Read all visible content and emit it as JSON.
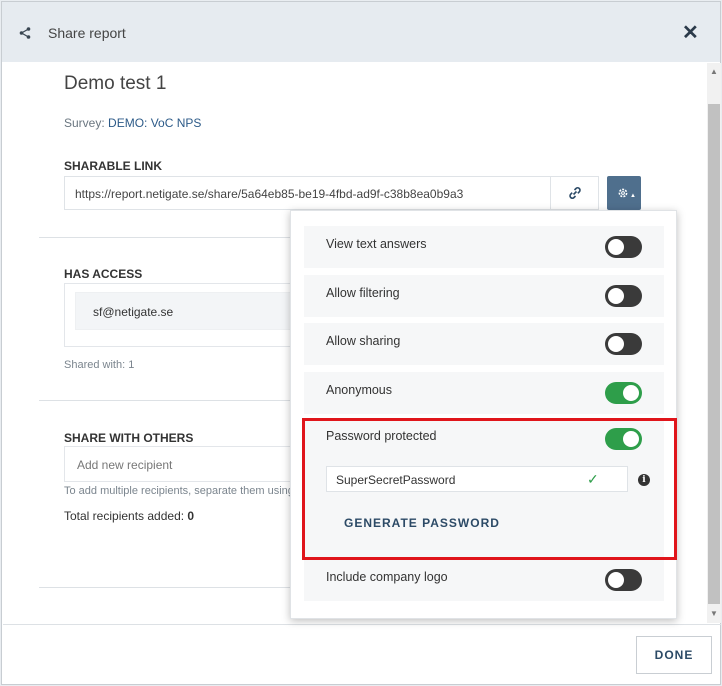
{
  "header": {
    "title": "Share report"
  },
  "report": {
    "title": "Demo test 1",
    "survey_label": "Survey:",
    "survey_value": "DEMO: VoC NPS"
  },
  "sharable_link": {
    "label": "SHARABLE LINK",
    "url": "https://report.netigate.se/share/5a64eb85-be19-4fbd-ad9f-c38b8ea0b9a3"
  },
  "has_access": {
    "label": "HAS ACCESS",
    "users": [
      "sf@netigate.se"
    ],
    "shared_with": "Shared with: 1"
  },
  "share_with_others": {
    "label": "SHARE WITH OTHERS",
    "placeholder": "Add new recipient",
    "hint": "To add multiple recipients, separate them using",
    "total_label": "Total recipients added:",
    "total_value": "0"
  },
  "settings": {
    "options": [
      {
        "label": "View text answers",
        "enabled": false
      },
      {
        "label": "Allow filtering",
        "enabled": false
      },
      {
        "label": "Allow sharing",
        "enabled": false
      },
      {
        "label": "Anonymous",
        "enabled": true
      },
      {
        "label": "Password protected",
        "enabled": true
      },
      {
        "label": "Include company logo",
        "enabled": false
      }
    ],
    "password_value": "SuperSecretPassword",
    "generate_label": "GENERATE PASSWORD"
  },
  "footer": {
    "done_label": "DONE"
  },
  "colors": {
    "accent": "#4f6f8d",
    "toggle_on": "#2e9e4a",
    "toggle_off": "#3a3a3a",
    "highlight": "#e0151b"
  }
}
